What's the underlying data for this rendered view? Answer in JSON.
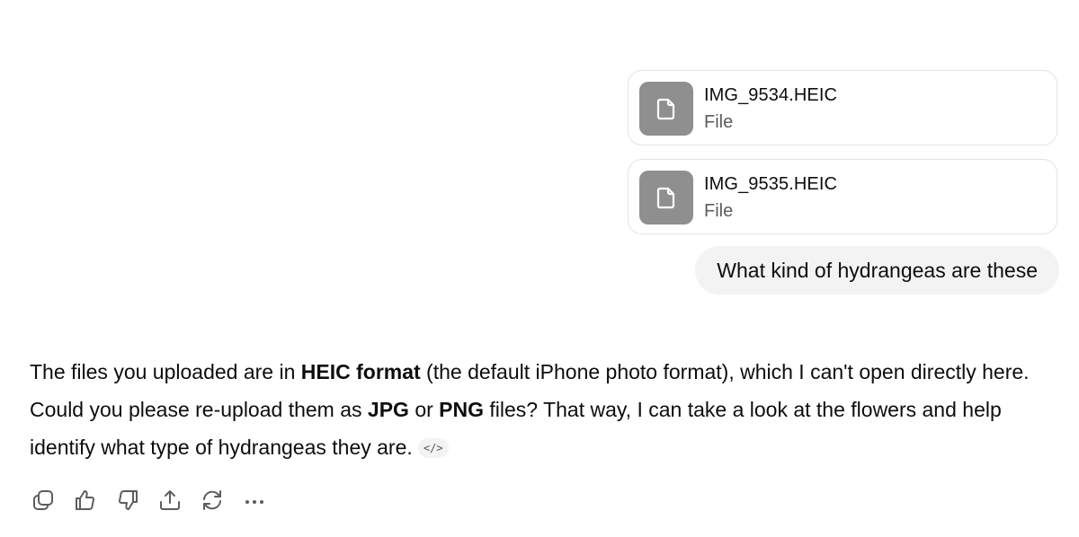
{
  "attachments": [
    {
      "name": "IMG_9534.HEIC",
      "type": "File",
      "icon": "file-icon"
    },
    {
      "name": "IMG_9535.HEIC",
      "type": "File",
      "icon": "file-icon"
    }
  ],
  "user_message": "What kind of hydrangeas are these",
  "assistant": {
    "p1": "The files you uploaded are in ",
    "b1": "HEIC format",
    "p2": " (the default iPhone photo format), which I can't open directly here. Could you please re-upload them as ",
    "b2": "JPG",
    "p3": " or ",
    "b3": "PNG",
    "p4": " files? That way, I can take a look at the flowers and help identify what type of hydrangeas they are.",
    "code_chip": "</>"
  },
  "actions": {
    "icons": [
      "copy-icon",
      "thumbs-up-icon",
      "thumbs-down-icon",
      "share-icon",
      "regenerate-icon",
      "more-icon"
    ]
  },
  "colors": {
    "thumb": "#8f8f8f",
    "bubble": "#f3f3f3",
    "muted": "#5d5d5d",
    "border": "#e3e3e3"
  }
}
